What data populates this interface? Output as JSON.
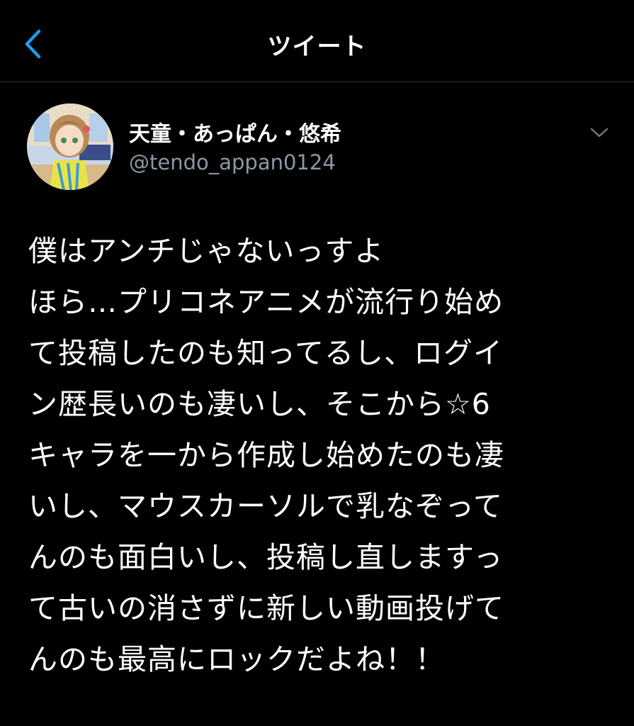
{
  "nav": {
    "title": "ツイート",
    "back_icon": "chevron-left-icon"
  },
  "author": {
    "display_name": "天童・あっぱん・悠希",
    "handle": "@tendo_appan0124",
    "avatar_icon": "avatar-illustration",
    "more_icon": "chevron-down-icon"
  },
  "tweet": {
    "lines": [
      "僕はアンチじゃないっすよ",
      "ほら…プリコネアニメが流行り始め",
      "て投稿したのも知ってるし、ログイ",
      "ン歴長いのも凄いし、そこから☆6",
      "キャラを一から作成し始めたのも凄",
      "いし、マウスカーソルで乳なぞって",
      "んのも面白いし、投稿し直しますっ",
      "て古いの消さずに新しい動画投げて",
      "んのも最高にロックだよね！！"
    ]
  },
  "colors": {
    "background": "#000000",
    "text": "#ffffff",
    "secondary_text": "#8b98a5",
    "accent": "#1d9bf0",
    "divider": "#2f3336"
  }
}
